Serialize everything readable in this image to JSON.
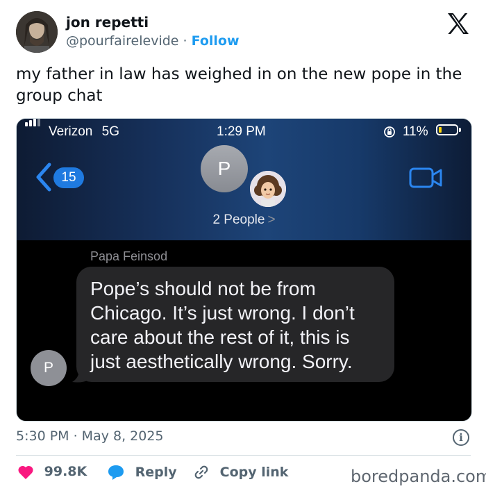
{
  "author": {
    "name": "jon repetti",
    "handle": "@pourfairelevide",
    "separator": "·",
    "follow_label": "Follow"
  },
  "tweet_text": "my father in law has weighed in on the new pope in the group chat",
  "screenshot": {
    "carrier": "Verizon",
    "network": "5G",
    "time": "1:29 PM",
    "battery": "11%",
    "back_count": "15",
    "group_avatar_letter": "P",
    "group_label": "2 People",
    "chevron": ">",
    "sender": "Papa Feinsod",
    "message_lines": [
      "Pope’s should not be from",
      "Chicago. It’s just wrong. I don’t",
      "care about the rest of it, this is",
      "just aesthetically wrong. Sorry."
    ],
    "sender_avatar_letter": "P"
  },
  "timestamp": "5:30 PM · May 8, 2025",
  "info_glyph": "i",
  "actions": {
    "like_count": "99.8K",
    "reply_label": "Reply",
    "copy_label": "Copy link"
  },
  "watermark": "boredpanda.com",
  "colors": {
    "like": "#f91880",
    "reply": "#1d9bf0",
    "link": "#1d9bf0",
    "imessage_blue": "#1f7ae0",
    "battery_low": "#ffd60a"
  },
  "icons": [
    "x-logo-icon",
    "signal-bars-icon",
    "rotation-lock-icon",
    "battery-icon",
    "back-chevron-icon",
    "video-camera-icon",
    "info-icon",
    "heart-icon",
    "reply-bubble-icon",
    "link-icon"
  ]
}
